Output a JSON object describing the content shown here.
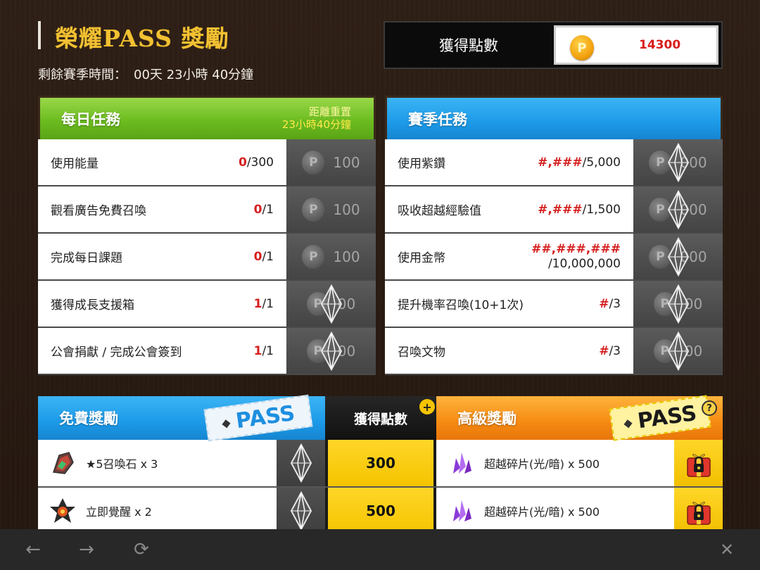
{
  "header": {
    "title": "榮耀PASS 獎勵",
    "season_label": "剩餘賽季時間：",
    "season_value": "00天 23小時 40分鐘",
    "points_label": "獲得點數",
    "points_value": "14300",
    "coin_letter": "P"
  },
  "daily": {
    "title": "每日任務",
    "reset_label": "距離重置",
    "reset_value": "23小時40分鐘",
    "rows": [
      {
        "name": "使用能量",
        "cur": "0",
        "total": "/300",
        "reward": "100",
        "locked": false
      },
      {
        "name": "觀看廣告免費召喚",
        "cur": "0",
        "total": "/1",
        "reward": "100",
        "locked": false
      },
      {
        "name": "完成每日課題",
        "cur": "0",
        "total": "/1",
        "reward": "100",
        "locked": false
      },
      {
        "name": "獲得成長支援箱",
        "cur": "1",
        "total": "/1",
        "reward": "00",
        "locked": true
      },
      {
        "name": "公會捐獻 / 完成公會簽到",
        "cur": "1",
        "total": "/1",
        "reward": "00",
        "locked": true
      }
    ]
  },
  "season": {
    "title": "賽季任務",
    "rows": [
      {
        "name": "使用紫鑽",
        "cur": "#,###",
        "total": "/5,000",
        "reward": "000"
      },
      {
        "name": "吸收超越經驗值",
        "cur": "#,###",
        "total": "/1,500",
        "reward": "000"
      },
      {
        "name": "使用金幣",
        "cur": "##,###,###",
        "total": "/10,000,000",
        "reward": "000"
      },
      {
        "name": "提升機率召喚(10+1次)",
        "cur": "#",
        "total": "/3",
        "reward": "00"
      },
      {
        "name": "召喚文物",
        "cur": "#",
        "total": "/3",
        "reward": "00"
      }
    ]
  },
  "rewards": {
    "free_title": "免費獎勵",
    "points_title": "獲得點數",
    "premium_title": "高級獎勵",
    "ticket_text": "PASS",
    "plus": "+",
    "question": "?",
    "rows": [
      {
        "free_item": "★5召喚石 x 3",
        "points": "300",
        "premium_item": "超越碎片(光/暗) x 500"
      },
      {
        "free_item": "立即覺醒 x 2",
        "points": "500",
        "premium_item": "超越碎片(光/暗) x 500"
      }
    ]
  },
  "browser": {
    "back": "←",
    "forward": "→",
    "reload": "⟳",
    "close": "✕"
  }
}
